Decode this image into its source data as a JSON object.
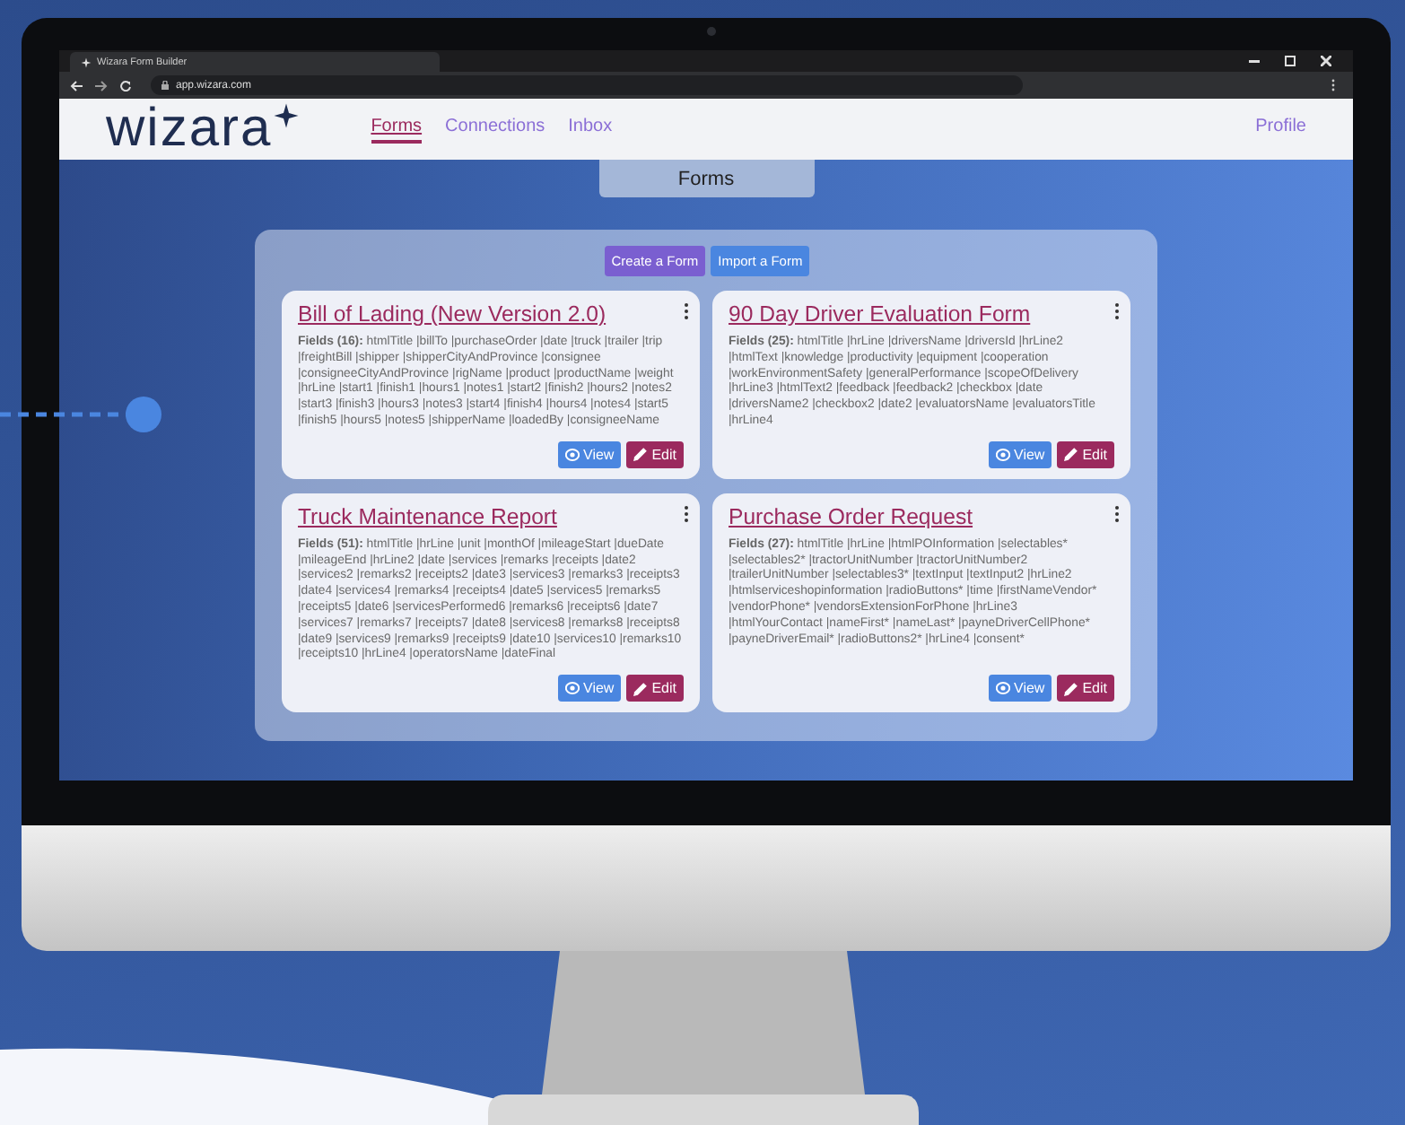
{
  "browser": {
    "tab_title": "Wizara Form Builder",
    "url": "app.wizara.com"
  },
  "nav": {
    "logo": "wizara",
    "items": [
      {
        "label": "Forms",
        "selected": true
      },
      {
        "label": "Connections",
        "selected": false
      },
      {
        "label": "Inbox",
        "selected": false
      }
    ],
    "profile": "Profile"
  },
  "page_title": "Forms",
  "actions": [
    {
      "label": "Create a Form",
      "kind": "create"
    },
    {
      "label": "Import a Form",
      "kind": "import"
    }
  ],
  "forms": [
    {
      "title": "Bill of Lading (New Version 2.0)",
      "fields": "**Fields (16):** htmlTitle |billTo |purchaseOrder |date |truck |trailer |trip |freightBill |shipper |shipperCityAndProvince |consignee |consigneeCityAndProvince |rigName |product |productName |weight |hrLine |start1 |finish1 |hours1 |notes1 |start2 |finish2 |hours2 |notes2 |start3 |finish3 |hours3 |notes3 |start4 |finish4 |hours4 |notes4 |start5 |finish5 |hours5 |notes5 |shipperName |loadedBy |consigneeName",
      "view": "View",
      "edit": "Edit"
    },
    {
      "title": "90 Day Driver Evaluation Form",
      "fields": "**Fields (25):** htmlTitle |hrLine |driversName |driversId |hrLine2 |htmlText |knowledge |productivity |equipment |cooperation |workEnvironmentSafety |generalPerformance |scopeOfDelivery |hrLine3 |htmlText2 |feedback |feedback2 |checkbox |date |driversName2 |checkbox2 |date2 |evaluatorsName |evaluatorsTitle |hrLine4",
      "view": "View",
      "edit": "Edit"
    },
    {
      "title": "Truck Maintenance Report",
      "fields": "**Fields (51):** htmlTitle |hrLine |unit |monthOf |mileageStart |dueDate |mileageEnd |hrLine2 |date |services |remarks |receipts |date2 |services2 |remarks2 |receipts2 |date3 |services3 |remarks3 |receipts3 |date4 |services4 |remarks4 |receipts4 |date5 |services5 |remarks5 |receipts5 |date6 |servicesPerformed6 |remarks6 |receipts6 |date7 |services7 |remarks7 |receipts7 |date8 |services8 |remarks8 |receipts8 |date9 |services9 |remarks9 |receipts9 |date10 |services10 |remarks10 |receipts10 |hrLine4 |operatorsName |dateFinal",
      "view": "View",
      "edit": "Edit"
    },
    {
      "title": "Purchase Order Request",
      "fields": "**Fields (27):** htmlTitle |hrLine |htmlPOInformation |selectables* |selectables2* |tractorUnitNumber |tractorUnitNumber2 |trailerUnitNumber |selectables3* |textInput |textInput2 |hrLine2 |htmlserviceshopinformation |radioButtons* |time |firstNameVendor* |vendorPhone* |vendorsExtensionForPhone |hrLine3 |htmlYourContact |nameFirst* |nameLast* |payneDriverCellPhone* |payneDriverEmail* |radioButtons2* |hrLine4 |consent*",
      "view": "View",
      "edit": "Edit"
    }
  ]
}
